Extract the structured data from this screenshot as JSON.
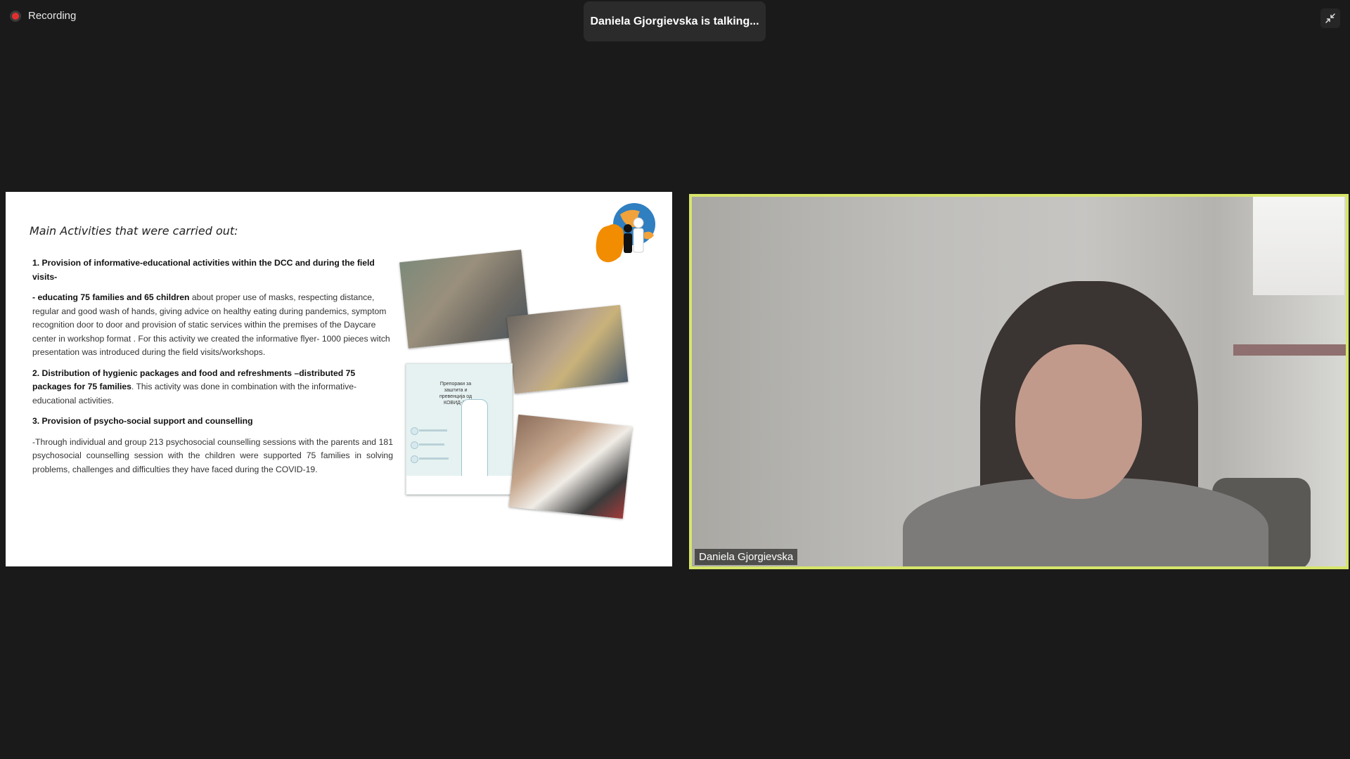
{
  "recording": {
    "label": "Recording"
  },
  "banner": {
    "talking_text": "Daniela Gjorgievska is talking..."
  },
  "slide": {
    "title": "Main Activities  that were carried out:",
    "item1_heading": "1. Provision of informative-educational activities within the DCC and during the field visits-",
    "item1_bold": "- educating 75 families and 65 children",
    "item1_body": " about proper use of masks, respecting distance, regular and good wash of hands, giving advice on healthy eating during pandemics, symptom recognition door to door and provision of static services within the premises of the Daycare center in workshop format . For this activity we created the informative flyer- 1000 pieces witch presentation was introduced during the field visits/workshops.",
    "item2_bold": "2. Distribution of hygienic packages and food and refreshments –distributed 75 packages for 75 families",
    "item2_body": ". This activity was done in combination with the informative-educational activities.",
    "item3_heading": "3. Provision of psycho-social support and counselling",
    "item3_body": "-Through individual and group 213 psychosocial counselling sessions with the parents and 181 psychosocial counselling session with the children were supported 75 families in solving problems, challenges and difficulties they have faced during the COVID-19.",
    "flyer_title": "Препораки за заштита и превенција од КОВИД-19"
  },
  "video": {
    "participant_name": "Daniela Gjorgievska"
  },
  "colors": {
    "speaker_border": "#d7e56a",
    "recording_dot": "#e02f2f",
    "background": "#1a1a1a"
  },
  "icons": {
    "recording": "record-icon",
    "minimize": "minimize-icon",
    "logo": "organization-logo-icon"
  }
}
